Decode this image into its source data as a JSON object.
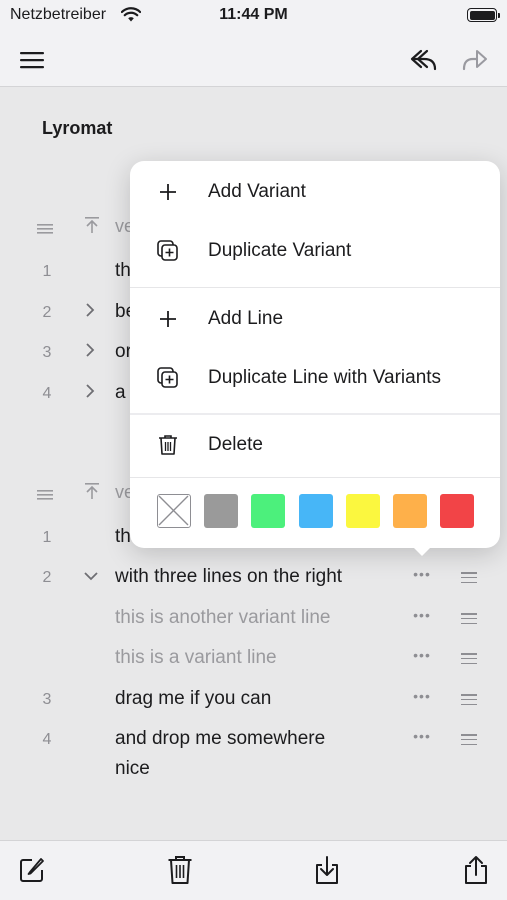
{
  "status_bar": {
    "carrier": "Netzbetreiber",
    "time": "11:44 PM",
    "wifi_icon": "wifi-icon",
    "battery_icon": "battery-icon"
  },
  "nav": {
    "menu_icon": "hamburger-menu-icon",
    "undo_icon": "undo-icon",
    "redo_icon": "redo-icon"
  },
  "song": {
    "title": "Lyromat"
  },
  "section1": {
    "header_partial": "ve",
    "lines": [
      {
        "num": "1",
        "text_partial": "th"
      },
      {
        "num": "2",
        "text_partial": "be"
      },
      {
        "num": "3",
        "text_partial": "or"
      },
      {
        "num": "4",
        "text_partial": "a"
      }
    ]
  },
  "section2": {
    "header_partial": "ve",
    "lines": [
      {
        "num": "1",
        "text": "th"
      },
      {
        "num": "2",
        "text": "with three lines on the right"
      },
      {
        "num": "",
        "text": "this is another variant line"
      },
      {
        "num": "",
        "text": "this is a variant line"
      },
      {
        "num": "3",
        "text": "drag me if you can"
      },
      {
        "num": "4",
        "text": "and drop me somewhere nice"
      }
    ],
    "line4_wrap": [
      "and drop me somewhere",
      "nice"
    ]
  },
  "context_menu": {
    "items": [
      {
        "label": "Add Variant",
        "icon": "plus-icon"
      },
      {
        "label": "Duplicate Variant",
        "icon": "duplicate-icon"
      },
      {
        "label": "Add Line",
        "icon": "plus-icon"
      },
      {
        "label": "Duplicate Line with Variants",
        "icon": "duplicate-icon"
      },
      {
        "label": "Delete",
        "icon": "trash-icon"
      }
    ],
    "colors": [
      "none",
      "#9a9a9a",
      "#4cf07c",
      "#47b6f7",
      "#fbf73f",
      "#feb04a",
      "#f24447"
    ]
  },
  "toolbar": {
    "compose_icon": "compose-icon",
    "delete_icon": "trash-icon",
    "import_icon": "download-tray-icon",
    "share_icon": "share-icon"
  }
}
